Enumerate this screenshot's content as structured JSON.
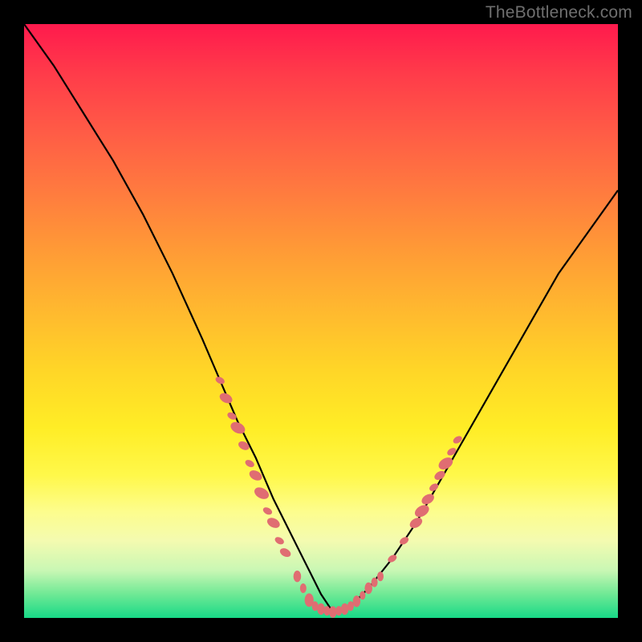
{
  "watermark": {
    "text": "TheBottleneck.com"
  },
  "colors": {
    "frame": "#000000",
    "curve": "#000000",
    "marker": "#e06d72",
    "gradient_stops": [
      "#ff1a4d",
      "#ff3a4a",
      "#ff5b46",
      "#ff7a3f",
      "#ff9a36",
      "#ffb82f",
      "#ffd527",
      "#ffed26",
      "#fff84a",
      "#fdfd8c",
      "#f4fbb0",
      "#c9f7b4",
      "#6fe995",
      "#18d987"
    ]
  },
  "chart_data": {
    "type": "line",
    "title": "",
    "xlabel": "",
    "ylabel": "",
    "xlim": [
      0,
      100
    ],
    "ylim": [
      0,
      100
    ],
    "note": "V-shaped bottleneck curve; y ≈ 100 is top (red), y ≈ 0 is bottom (green). Minimum near x≈52. Left branch starts at top-left corner.",
    "series": [
      {
        "name": "bottleneck-curve",
        "x": [
          0,
          5,
          10,
          15,
          20,
          25,
          30,
          33,
          36,
          39,
          42,
          45,
          48,
          50,
          52,
          55,
          58,
          62,
          66,
          70,
          74,
          78,
          82,
          86,
          90,
          95,
          100
        ],
        "y": [
          100,
          93,
          85,
          77,
          68,
          58,
          47,
          40,
          33,
          27,
          20,
          14,
          8,
          4,
          1,
          2,
          5,
          10,
          16,
          23,
          30,
          37,
          44,
          51,
          58,
          65,
          72
        ]
      }
    ],
    "markers": {
      "name": "highlighted-points",
      "note": "Salmon bead-like markers clustered on lower legs of the V and along the flat bottom.",
      "points": [
        {
          "x": 33,
          "y": 40,
          "r": 1.0
        },
        {
          "x": 34,
          "y": 37,
          "r": 1.4
        },
        {
          "x": 35,
          "y": 34,
          "r": 1.0
        },
        {
          "x": 36,
          "y": 32,
          "r": 1.6
        },
        {
          "x": 37,
          "y": 29,
          "r": 1.2
        },
        {
          "x": 38,
          "y": 26,
          "r": 1.0
        },
        {
          "x": 39,
          "y": 24,
          "r": 1.4
        },
        {
          "x": 40,
          "y": 21,
          "r": 1.6
        },
        {
          "x": 41,
          "y": 18,
          "r": 1.0
        },
        {
          "x": 42,
          "y": 16,
          "r": 1.4
        },
        {
          "x": 43,
          "y": 13,
          "r": 1.0
        },
        {
          "x": 44,
          "y": 11,
          "r": 1.2
        },
        {
          "x": 46,
          "y": 7,
          "r": 1.2
        },
        {
          "x": 47,
          "y": 5,
          "r": 1.0
        },
        {
          "x": 48,
          "y": 3,
          "r": 1.4
        },
        {
          "x": 49,
          "y": 2,
          "r": 1.0
        },
        {
          "x": 50,
          "y": 1.5,
          "r": 1.2
        },
        {
          "x": 51,
          "y": 1.2,
          "r": 1.0
        },
        {
          "x": 52,
          "y": 1.0,
          "r": 1.2
        },
        {
          "x": 53,
          "y": 1.2,
          "r": 1.0
        },
        {
          "x": 54,
          "y": 1.5,
          "r": 1.2
        },
        {
          "x": 55,
          "y": 2.0,
          "r": 1.0
        },
        {
          "x": 56,
          "y": 2.8,
          "r": 1.2
        },
        {
          "x": 57,
          "y": 3.8,
          "r": 0.9
        },
        {
          "x": 58,
          "y": 5.0,
          "r": 1.2
        },
        {
          "x": 59,
          "y": 6.0,
          "r": 1.0
        },
        {
          "x": 60,
          "y": 7.0,
          "r": 1.0
        },
        {
          "x": 62,
          "y": 10.0,
          "r": 1.0
        },
        {
          "x": 64,
          "y": 13.0,
          "r": 1.0
        },
        {
          "x": 66,
          "y": 16.0,
          "r": 1.4
        },
        {
          "x": 67,
          "y": 18.0,
          "r": 1.6
        },
        {
          "x": 68,
          "y": 20.0,
          "r": 1.4
        },
        {
          "x": 69,
          "y": 22.0,
          "r": 1.0
        },
        {
          "x": 70,
          "y": 24.0,
          "r": 1.2
        },
        {
          "x": 71,
          "y": 26.0,
          "r": 1.6
        },
        {
          "x": 72,
          "y": 28.0,
          "r": 1.0
        },
        {
          "x": 73,
          "y": 30.0,
          "r": 1.0
        }
      ]
    }
  }
}
